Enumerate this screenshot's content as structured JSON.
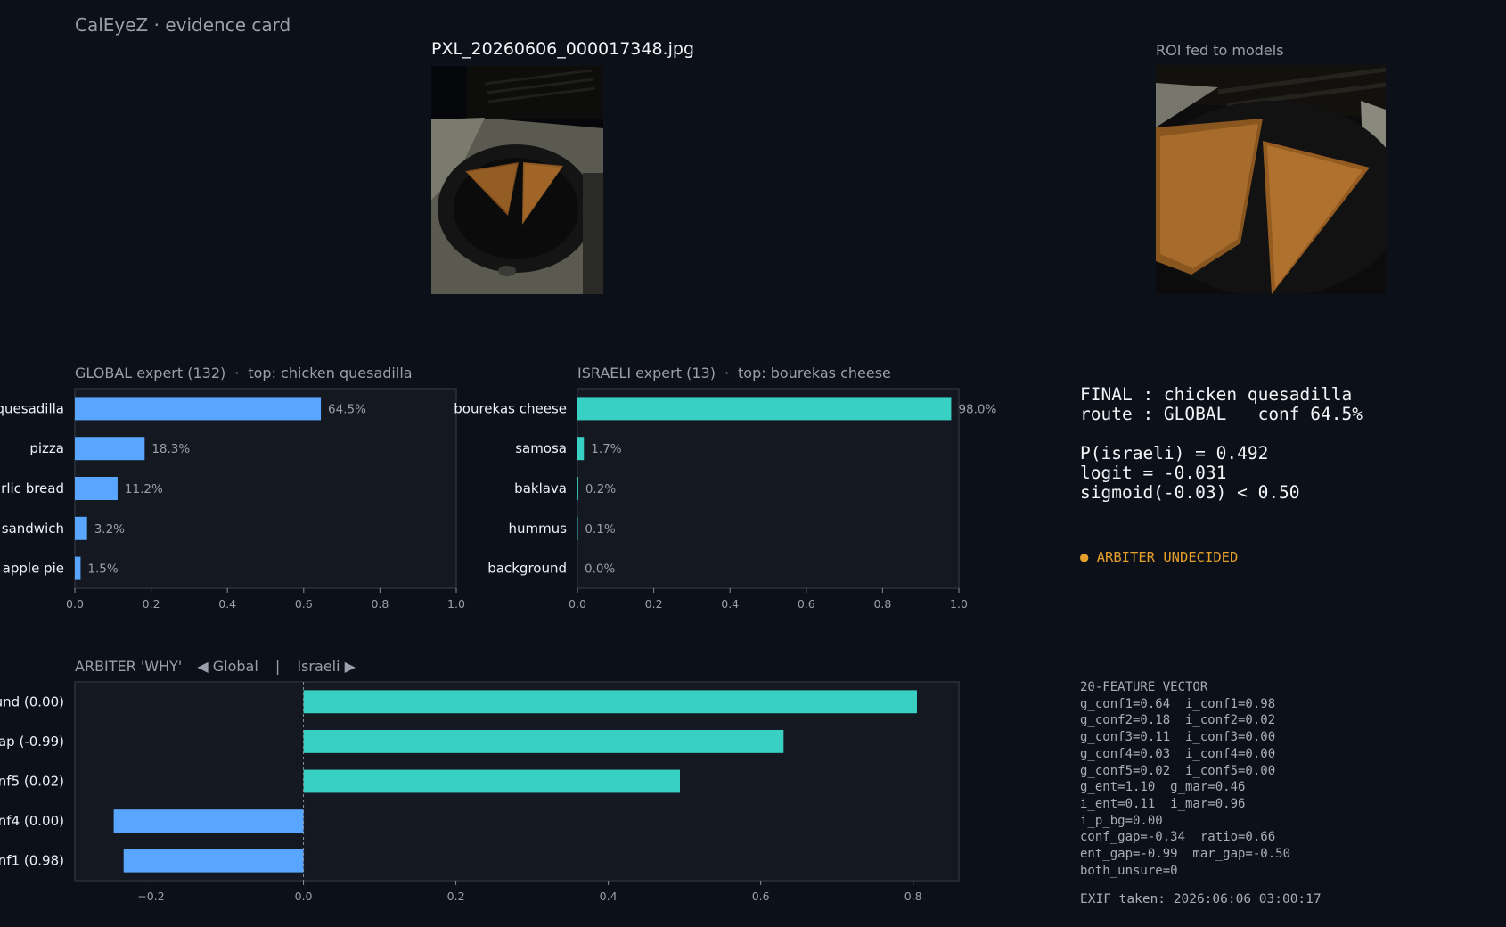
{
  "app": {
    "title": "CalEyeZ · evidence card"
  },
  "photo": {
    "filename": "PXL_20260606_000017348.jpg"
  },
  "roi": {
    "title": "ROI fed to models"
  },
  "global_panel": {
    "name": "GLOBAL expert (132)",
    "sep": "·",
    "top_label": "top: chicken quesadilla"
  },
  "israeli_panel": {
    "name": "ISRAELI expert (13)",
    "sep": "·",
    "top_label": "top: bourekas cheese"
  },
  "arbiter_panel": {
    "title": "ARBITER 'WHY'",
    "left_arrow": "◀ Global",
    "divider": "|",
    "right_arrow": "Israeli ▶"
  },
  "final_block": {
    "final_line": "FINAL : chicken quesadilla",
    "route_line": "route : GLOBAL   conf 64.5%",
    "p_line": "P(israeli) = 0.492",
    "logit_line": "logit = -0.031",
    "sigmoid_line": "sigmoid(-0.03) < 0.50"
  },
  "arbiter_status": {
    "dot": "●",
    "label": "ARBITER UNDECIDED"
  },
  "feature_vector": {
    "header": "20-FEATURE VECTOR",
    "lines": [
      "g_conf1=0.64  i_conf1=0.98",
      "g_conf2=0.18  i_conf2=0.02",
      "g_conf3=0.11  i_conf3=0.00",
      "g_conf4=0.03  i_conf4=0.00",
      "g_conf5=0.02  i_conf5=0.00",
      "g_ent=1.10  g_mar=0.46",
      "i_ent=0.11  i_mar=0.96",
      "i_p_bg=0.00",
      "conf_gap=-0.34  ratio=0.66",
      "ent_gap=-0.99  mar_gap=-0.50",
      "both_unsure=0"
    ]
  },
  "exif": {
    "text": "EXIF taken: 2026:06:06 03:00:17"
  },
  "colors": {
    "global": "#58a6ff",
    "israeli": "#39d0c4",
    "panel_bg": "#131821",
    "panel_border": "#2b313b",
    "undecided": "#e5a02c"
  },
  "chart_data": [
    {
      "id": "global",
      "type": "bar",
      "orientation": "horizontal",
      "categories": [
        "quesadilla",
        "pizza",
        "arlic bread",
        "sandwich",
        "apple pie"
      ],
      "values": [
        0.645,
        0.183,
        0.112,
        0.032,
        0.015
      ],
      "value_labels": [
        "64.5%",
        "18.3%",
        "11.2%",
        "3.2%",
        "1.5%"
      ],
      "xlim": [
        0,
        1.0
      ],
      "xticks": [
        0.0,
        0.2,
        0.4,
        0.6,
        0.8,
        1.0
      ],
      "xtick_labels": [
        "0.0",
        "0.2",
        "0.4",
        "0.6",
        "0.8",
        "1.0"
      ],
      "color": "#58a6ff"
    },
    {
      "id": "israeli",
      "type": "bar",
      "orientation": "horizontal",
      "categories": [
        "bourekas cheese",
        "samosa",
        "baklava",
        "hummus",
        "background"
      ],
      "values": [
        0.98,
        0.017,
        0.002,
        0.001,
        0.0
      ],
      "value_labels": [
        "98.0%",
        "1.7%",
        "0.2%",
        "0.1%",
        "0.0%"
      ],
      "xlim": [
        0,
        1.0
      ],
      "xticks": [
        0.0,
        0.2,
        0.4,
        0.6,
        0.8,
        1.0
      ],
      "xtick_labels": [
        "0.0",
        "0.2",
        "0.4",
        "0.6",
        "0.8",
        "1.0"
      ],
      "color": "#39d0c4"
    },
    {
      "id": "arbiter",
      "type": "bar",
      "orientation": "horizontal",
      "categories": [
        "ound (0.00)",
        "gap (-0.99)",
        "onf5 (0.02)",
        "onf4 (0.00)",
        "onf1 (0.98)"
      ],
      "values": [
        0.805,
        0.63,
        0.494,
        -0.249,
        -0.236
      ],
      "xlim": [
        -0.3,
        0.86
      ],
      "xticks": [
        -0.2,
        0.0,
        0.2,
        0.4,
        0.6,
        0.8
      ],
      "xtick_labels": [
        "−0.2",
        "0.0",
        "0.2",
        "0.4",
        "0.6",
        "0.8"
      ],
      "positive_color": "#39d0c4",
      "negative_color": "#58a6ff"
    }
  ]
}
